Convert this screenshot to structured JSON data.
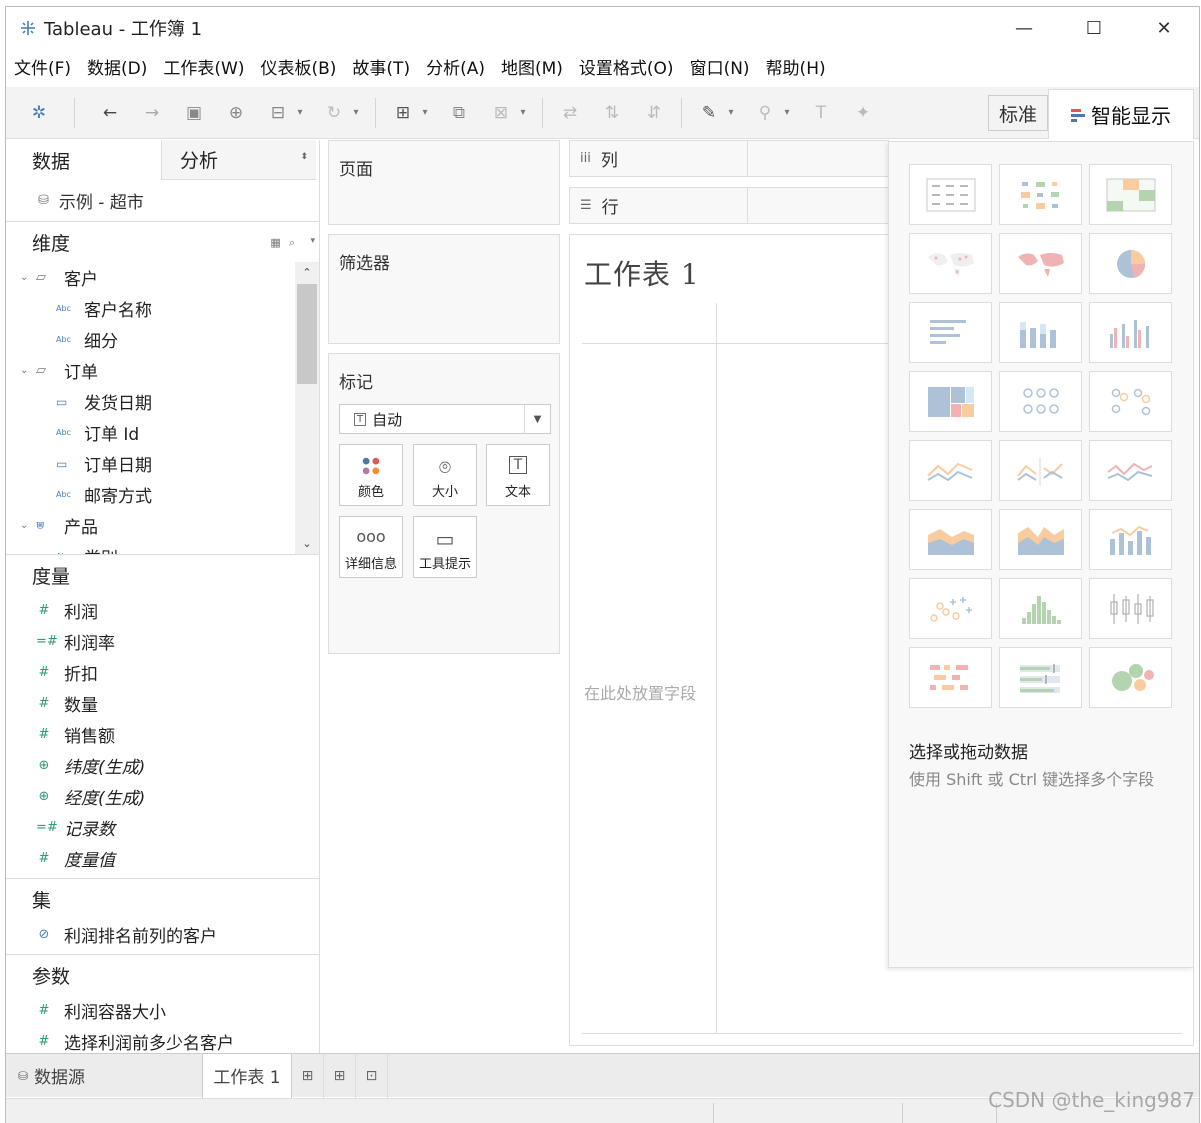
{
  "window": {
    "title": "Tableau - 工作簿 1",
    "minimize": "—",
    "maximize": "☐",
    "close": "✕"
  },
  "menu": [
    "文件(F)",
    "数据(D)",
    "工作表(W)",
    "仪表板(B)",
    "故事(T)",
    "分析(A)",
    "地图(M)",
    "设置格式(O)",
    "窗口(N)",
    "帮助(H)"
  ],
  "toolbar": {
    "standard_label": "标准",
    "smart_display_label": "智能显示"
  },
  "data_pane": {
    "tab_data": "数据",
    "tab_analysis": "分析",
    "datasource": "示例 - 超市",
    "dimensions_label": "维度",
    "dimensions": [
      {
        "kind": "folder",
        "name": "客户"
      },
      {
        "kind": "field",
        "type": "Abc",
        "name": "客户名称"
      },
      {
        "kind": "field",
        "type": "Abc",
        "name": "细分"
      },
      {
        "kind": "folder",
        "name": "订单"
      },
      {
        "kind": "field",
        "type": "date",
        "name": "发货日期"
      },
      {
        "kind": "field",
        "type": "Abc",
        "name": "订单 Id"
      },
      {
        "kind": "field",
        "type": "date",
        "name": "订单日期"
      },
      {
        "kind": "field",
        "type": "Abc",
        "name": "邮寄方式"
      },
      {
        "kind": "hierarchy",
        "name": "产品"
      },
      {
        "kind": "field",
        "type": "Abc",
        "name": "类别"
      }
    ],
    "measures_label": "度量",
    "measures": [
      {
        "icon": "#",
        "name": "利润",
        "italic": false
      },
      {
        "icon": "=#",
        "name": "利润率",
        "italic": false
      },
      {
        "icon": "#",
        "name": "折扣",
        "italic": false
      },
      {
        "icon": "#",
        "name": "数量",
        "italic": false
      },
      {
        "icon": "#",
        "name": "销售额",
        "italic": false
      },
      {
        "icon": "globe",
        "name": "纬度(生成)",
        "italic": true
      },
      {
        "icon": "globe",
        "name": "经度(生成)",
        "italic": true
      },
      {
        "icon": "=#",
        "name": "记录数",
        "italic": true
      },
      {
        "icon": "#",
        "name": "度量值",
        "italic": true
      }
    ],
    "sets_label": "集",
    "sets": [
      "利润排名前列的客户"
    ],
    "params_label": "参数",
    "params": [
      "利润容器大小",
      "选择利润前多少名客户"
    ]
  },
  "shelves": {
    "pages": "页面",
    "filters": "筛选器",
    "marks": "标记",
    "marks_type": "自动",
    "mark_buttons": [
      "颜色",
      "大小",
      "文本",
      "详细信息",
      "工具提示"
    ],
    "columns": "列",
    "rows": "行"
  },
  "sheet": {
    "title": "工作表 1",
    "drop_hint": "在此处放置字段"
  },
  "smart_display": {
    "heading": "选择或拖动数据",
    "description": "使用 Shift 或 Ctrl 键选择多个字段",
    "chart_types": [
      "text-table",
      "heat-map",
      "highlight-table",
      "symbol-map",
      "filled-map",
      "pie-chart",
      "horizontal-bars",
      "stacked-bars",
      "side-by-side-bars",
      "treemap",
      "circle-views",
      "side-by-side-circles",
      "line-continuous",
      "line-discrete",
      "dual-lines",
      "area-continuous",
      "area-discrete",
      "dual-combination",
      "scatter-plot",
      "histogram",
      "box-plot",
      "gantt-chart",
      "bullet-graph",
      "packed-bubbles"
    ]
  },
  "bottom": {
    "datasource_tab": "数据源",
    "sheet_tab": "工作表 1"
  },
  "watermark": "CSDN @the_king987",
  "colors": {
    "accent_blue": "#4a7fb8",
    "measure_green": "#2e9a7a",
    "pane_bg": "#f8f8f8"
  }
}
